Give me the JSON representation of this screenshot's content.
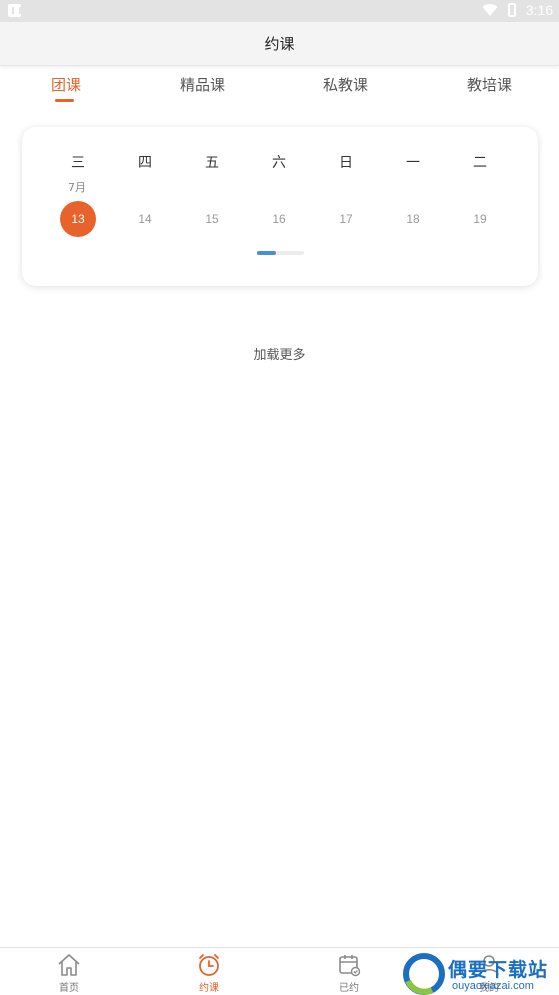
{
  "status_bar": {
    "time": "3:16"
  },
  "app_bar": {
    "title": "约课"
  },
  "tabs": [
    {
      "label": "团课",
      "active": true
    },
    {
      "label": "精品课",
      "active": false
    },
    {
      "label": "私教课",
      "active": false
    },
    {
      "label": "教培课",
      "active": false
    }
  ],
  "calendar": {
    "month_label": "7月",
    "weekdays": [
      "三",
      "四",
      "五",
      "六",
      "日",
      "一",
      "二"
    ],
    "days": [
      "13",
      "14",
      "15",
      "16",
      "17",
      "18",
      "19"
    ],
    "selected_day": "13",
    "page_indicator": {
      "current": 1,
      "total": 3
    }
  },
  "list": {
    "load_more": "加载更多"
  },
  "bottom_nav": [
    {
      "label": "首页",
      "icon": "home-icon",
      "active": false
    },
    {
      "label": "约课",
      "icon": "alarm-clock-icon",
      "active": true
    },
    {
      "label": "已约",
      "icon": "calendar-check-icon",
      "active": false
    },
    {
      "label": "我的",
      "icon": "user-icon",
      "active": false
    }
  ],
  "watermark": {
    "title": "偶要下载站",
    "subtitle": "ouyaoxiazai.com"
  },
  "colors": {
    "accent": "#e8632b",
    "indicator": "#4a8fd6",
    "status_bar": "#e3e3e3",
    "watermark": "#1b6fc2"
  }
}
